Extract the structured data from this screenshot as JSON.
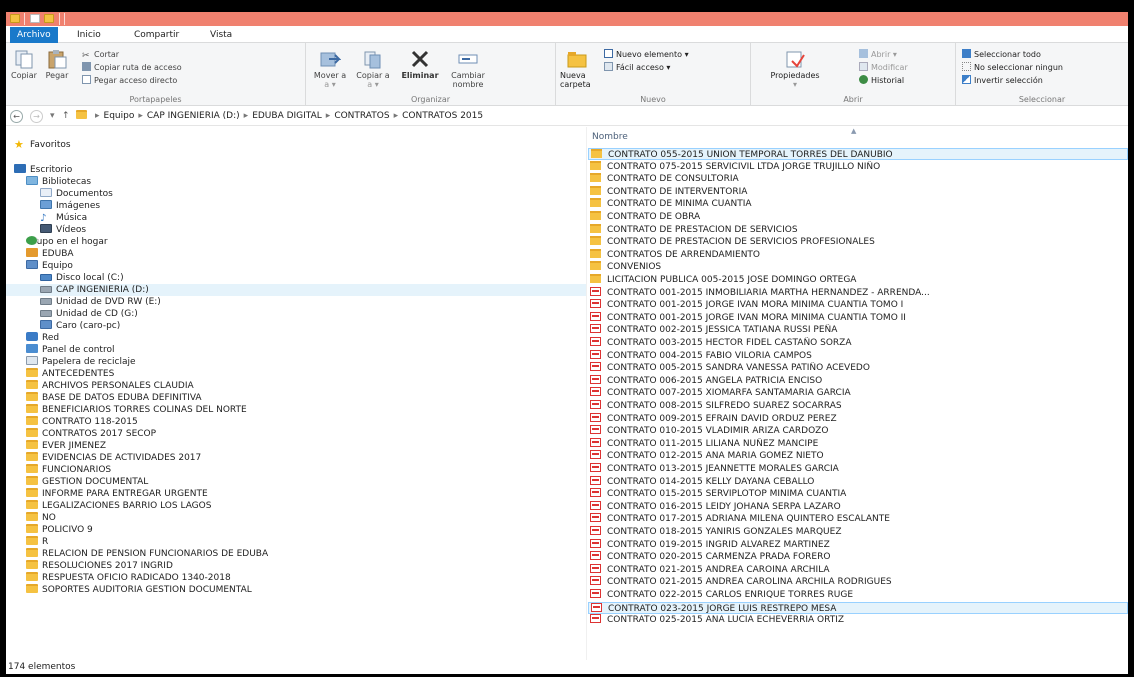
{
  "ribbon_tabs": [
    {
      "label": "Archivo",
      "active": true
    },
    {
      "label": "Inicio",
      "active": false
    },
    {
      "label": "Compartir",
      "active": false
    },
    {
      "label": "Vista",
      "active": false
    }
  ],
  "ribbon": {
    "portapapeles": {
      "label": "Portapapeles",
      "copiar": "Copiar",
      "pegar": "Pegar",
      "cortar": "Cortar",
      "copiar_ruta": "Copiar ruta de acceso",
      "pegar_acceso": "Pegar acceso directo"
    },
    "organizar": {
      "label": "Organizar",
      "mover_a": "Mover a",
      "copiar_a": "Copiar a",
      "eliminar": "Eliminar",
      "cambiar_nombre": "Cambiar nombre",
      "dropdown_a": "a ▾"
    },
    "nuevo": {
      "label": "Nuevo",
      "nueva_carpeta": "Nueva carpeta",
      "nuevo_elemento": "Nuevo elemento ▾",
      "facil_acceso": "Fácil acceso ▾"
    },
    "abrir": {
      "label": "Abrir",
      "propiedades": "Propiedades",
      "abrir": "Abrir ▾",
      "modificar": "Modificar",
      "historial": "Historial"
    },
    "seleccionar": {
      "label": "Seleccionar",
      "todo": "Seleccionar todo",
      "ninguno": "No seleccionar ningun",
      "invertir": "Invertir selección"
    }
  },
  "address": {
    "crumbs": [
      "Equipo",
      "CAP INGENIERIA (D:)",
      "EDUBA DIGITAL",
      "CONTRATOS",
      "CONTRATOS 2015"
    ]
  },
  "nav": [
    {
      "label": "Favoritos",
      "icon": "star-icon"
    },
    {
      "label": "Escritorio",
      "icon": "desktop-icon"
    },
    {
      "label": "Bibliotecas",
      "icon": "libraries-icon"
    },
    {
      "label": "Documentos",
      "icon": "documents-icon"
    },
    {
      "label": "Imágenes",
      "icon": "pictures-icon"
    },
    {
      "label": "Música",
      "icon": "music-icon"
    },
    {
      "label": "Vídeos",
      "icon": "videos-icon"
    },
    {
      "label": "Grupo en el hogar",
      "icon": "homegroup-icon"
    },
    {
      "label": "EDUBA",
      "icon": "user-folder-icon"
    },
    {
      "label": "Equipo",
      "icon": "computer-icon"
    },
    {
      "label": "Disco local (C:)",
      "icon": "drive-c-icon"
    },
    {
      "label": "CAP INGENIERIA (D:)",
      "icon": "drive-icon"
    },
    {
      "label": "Unidad de DVD RW (E:)",
      "icon": "dvd-drive-icon"
    },
    {
      "label": "Unidad de CD (G:)",
      "icon": "cd-drive-icon"
    },
    {
      "label": "Caro (caro-pc)",
      "icon": "network-computer-icon"
    },
    {
      "label": "Red",
      "icon": "network-icon"
    },
    {
      "label": "Panel de control",
      "icon": "control-panel-icon"
    },
    {
      "label": "Papelera de reciclaje",
      "icon": "recycle-bin-icon"
    },
    {
      "label": "ANTECEDENTES",
      "icon": "folder-icon"
    },
    {
      "label": "ARCHIVOS PERSONALES  CLAUDIA",
      "icon": "folder-icon"
    },
    {
      "label": "BASE DE DATOS EDUBA DEFINITIVA",
      "icon": "folder-icon"
    },
    {
      "label": "BENEFICIARIOS TORRES COLINAS DEL NORTE",
      "icon": "folder-icon"
    },
    {
      "label": "CONTRATO 118-2015",
      "icon": "folder-icon"
    },
    {
      "label": "CONTRATOS 2017 SECOP",
      "icon": "folder-icon"
    },
    {
      "label": "EVER JIMENEZ",
      "icon": "folder-icon"
    },
    {
      "label": "EVIDENCIAS DE ACTIVIDADES 2017",
      "icon": "folder-icon"
    },
    {
      "label": "FUNCIONARIOS",
      "icon": "folder-icon"
    },
    {
      "label": "GESTION DOCUMENTAL",
      "icon": "folder-icon"
    },
    {
      "label": "INFORME PARA ENTREGAR URGENTE",
      "icon": "folder-icon"
    },
    {
      "label": "LEGALIZACIONES BARRIO LOS LAGOS",
      "icon": "folder-icon"
    },
    {
      "label": "NO",
      "icon": "folder-icon"
    },
    {
      "label": "POLICIVO 9",
      "icon": "folder-icon"
    },
    {
      "label": "R",
      "icon": "folder-icon"
    },
    {
      "label": "RELACION DE PENSION FUNCIONARIOS DE EDUBA",
      "icon": "folder-icon"
    },
    {
      "label": "RESOLUCIONES 2017 INGRID",
      "icon": "folder-icon"
    },
    {
      "label": "RESPUESTA OFICIO RADICADO 1340-2018",
      "icon": "folder-icon"
    },
    {
      "label": "SOPORTES AUDITORIA GESTION DOCUMENTAL",
      "icon": "folder-icon"
    }
  ],
  "content": {
    "column_header": "Nombre",
    "files": [
      {
        "name": "CONTRATO 055-2015 UNION TEMPORAL TORRES DEL DANUBIO",
        "type": "folder",
        "selected": true
      },
      {
        "name": "CONTRATO 075-2015 SERVICIVIL LTDA JORGE TRUJILLO NIÑO",
        "type": "folder"
      },
      {
        "name": "CONTRATO DE CONSULTORIA",
        "type": "folder"
      },
      {
        "name": "CONTRATO DE INTERVENTORIA",
        "type": "folder"
      },
      {
        "name": "CONTRATO DE MINIMA CUANTIA",
        "type": "folder"
      },
      {
        "name": "CONTRATO DE OBRA",
        "type": "folder"
      },
      {
        "name": "CONTRATO DE PRESTACION DE SERVICIOS",
        "type": "folder"
      },
      {
        "name": "CONTRATO DE PRESTACION DE SERVICIOS PROFESIONALES",
        "type": "folder"
      },
      {
        "name": "CONTRATOS DE ARRENDAMIENTO",
        "type": "folder"
      },
      {
        "name": "CONVENIOS",
        "type": "folder"
      },
      {
        "name": "LICITACION PUBLICA 005-2015 JOSE DOMINGO ORTEGA",
        "type": "folder"
      },
      {
        "name": "CONTRATO 001-2015 INMOBILIARIA MARTHA HERNANDEZ - ARRENDA...",
        "type": "pdf"
      },
      {
        "name": "CONTRATO 001-2015 JORGE IVAN MORA MINIMA CUANTIA TOMO I",
        "type": "pdf"
      },
      {
        "name": "CONTRATO 001-2015 JORGE IVAN MORA MINIMA CUANTIA TOMO II",
        "type": "pdf"
      },
      {
        "name": "CONTRATO 002-2015 JESSICA TATIANA RUSSI PEÑA",
        "type": "pdf"
      },
      {
        "name": "CONTRATO 003-2015 HECTOR FIDEL CASTAÑO SORZA",
        "type": "pdf"
      },
      {
        "name": "CONTRATO 004-2015 FABIO VILORIA CAMPOS",
        "type": "pdf"
      },
      {
        "name": "CONTRATO 005-2015 SANDRA VANESSA PATIÑO ACEVEDO",
        "type": "pdf"
      },
      {
        "name": "CONTRATO 006-2015 ANGELA PATRICIA ENCISO",
        "type": "pdf"
      },
      {
        "name": "CONTRATO 007-2015 XIOMARFA SANTAMARIA GARCIA",
        "type": "pdf"
      },
      {
        "name": "CONTRATO 008-2015 SILFREDO SUAREZ SOCARRAS",
        "type": "pdf"
      },
      {
        "name": "CONTRATO 009-2015 EFRAIN DAVID ORDUZ PEREZ",
        "type": "pdf"
      },
      {
        "name": "CONTRATO 010-2015 VLADIMIR ARIZA CARDOZO",
        "type": "pdf"
      },
      {
        "name": "CONTRATO 011-2015 LILIANA NUÑEZ MANCIPE",
        "type": "pdf"
      },
      {
        "name": "CONTRATO 012-2015 ANA MARIA GOMEZ NIETO",
        "type": "pdf"
      },
      {
        "name": "CONTRATO 013-2015 JEANNETTE MORALES GARCIA",
        "type": "pdf"
      },
      {
        "name": "CONTRATO 014-2015 KELLY DAYANA CEBALLO",
        "type": "pdf"
      },
      {
        "name": "CONTRATO 015-2015 SERVIPLOTOP MINIMA CUANTIA",
        "type": "pdf"
      },
      {
        "name": "CONTRATO 016-2015 LEIDY JOHANA SERPA LAZARO",
        "type": "pdf"
      },
      {
        "name": "CONTRATO 017-2015 ADRIANA MILENA QUINTERO ESCALANTE",
        "type": "pdf"
      },
      {
        "name": "CONTRATO 018-2015 YANIRIS GONZALES MARQUEZ",
        "type": "pdf"
      },
      {
        "name": "CONTRATO 019-2015 INGRID ALVAREZ MARTINEZ",
        "type": "pdf"
      },
      {
        "name": "CONTRATO 020-2015 CARMENZA PRADA FORERO",
        "type": "pdf"
      },
      {
        "name": "CONTRATO 021-2015 ANDREA CAROINA ARCHILA",
        "type": "pdf"
      },
      {
        "name": "CONTRATO 021-2015 ANDREA CAROLINA ARCHILA RODRIGUES",
        "type": "pdf"
      },
      {
        "name": "CONTRATO 022-2015 CARLOS ENRIQUE TORRES RUGE",
        "type": "pdf"
      },
      {
        "name": "CONTRATO 023-2015 JORGE LUIS RESTREPO MESA",
        "type": "pdf",
        "selected": true
      },
      {
        "name": "CONTRATO 025-2015 ANA LUCIA ECHEVERRIA ORTIZ",
        "type": "pdf"
      }
    ]
  },
  "status": "174 elementos"
}
